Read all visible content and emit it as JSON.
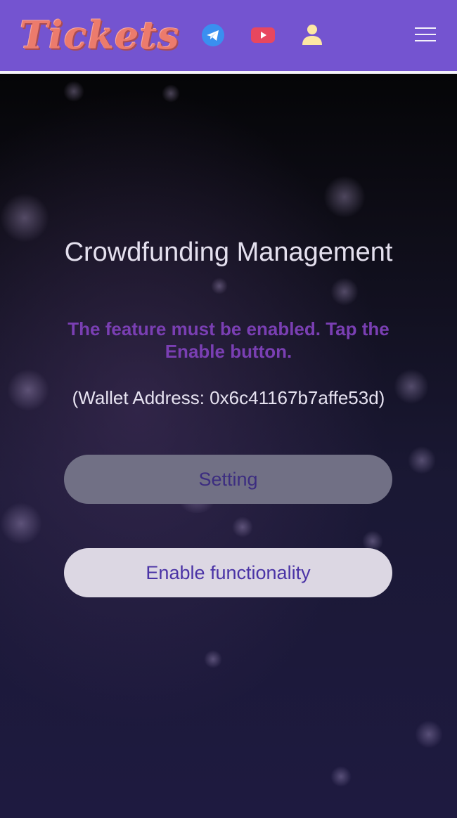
{
  "header": {
    "logo_text": "Tickets",
    "icons": [
      "telegram-icon",
      "youtube-icon",
      "user-icon",
      "hamburger-menu-icon"
    ],
    "background_color": "#7454d0",
    "logo_color": "#ec7b6c"
  },
  "main": {
    "title": "Crowdfunding Management",
    "warning": "The feature must be enabled. Tap the Enable button.",
    "wallet_address": "(Wallet Address: 0x6c41167b7affe53d)",
    "buttons": {
      "setting_label": "Setting",
      "enable_label": "Enable functionality"
    },
    "warning_color": "#7a3fb3"
  }
}
